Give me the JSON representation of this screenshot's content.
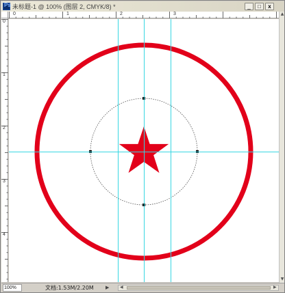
{
  "window": {
    "app_icon_glyph": "Ps",
    "title": "未标题-1 @ 100% (图层 2, CMYK/8) *",
    "controls": {
      "minimize": "_",
      "maximize": "□",
      "close": "x"
    }
  },
  "rulers": {
    "top_labels": [
      "0",
      "1",
      "2",
      "3"
    ],
    "left_labels": [
      "0",
      "1",
      "2",
      "3",
      "4"
    ]
  },
  "status": {
    "zoom": "100%",
    "doc_info": "文档:1.53M/2.20M"
  },
  "colors": {
    "shape_red": "#e2001a",
    "guide_cyan": "#36d6e2"
  },
  "icons": {
    "status_arrow": "▶",
    "scroll_left": "◀",
    "scroll_right": "▶",
    "scroll_up": "▲",
    "scroll_down": "▼"
  }
}
